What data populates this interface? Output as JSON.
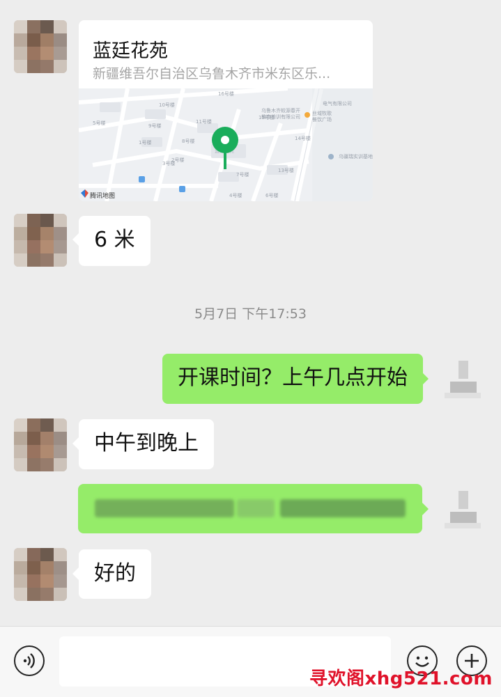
{
  "location": {
    "name": "蓝廷花苑",
    "address": "新疆维吾尔自治区乌鲁木齐市米东区乐...",
    "map_attribution": "腾讯地图",
    "map_labels": {
      "building_label": "蓝廷花苑",
      "poi1": "乌鲁木齐蛟源春开",
      "poi1_line2": "教育培训有限公司",
      "poi2": "丝域牧歌",
      "poi2_line2": "餐饮广场",
      "poi3": "电气有限公司",
      "poi4": "乌疆瑞实训基地",
      "road": "紫阳路",
      "buildings": [
        "16号楼",
        "10号楼",
        "11号楼",
        "9号楼",
        "8号楼",
        "1号楼",
        "3号楼",
        "2号楼",
        "15号楼",
        "14号楼",
        "13号楼",
        "7号楼",
        "4号楼",
        "5号楼",
        "6号楼"
      ]
    }
  },
  "messages": [
    {
      "side": "in",
      "text": "6 米"
    },
    {
      "side": "time",
      "text": "5月7日 下午17:53"
    },
    {
      "side": "out",
      "text": "开课时间？上午几点开始"
    },
    {
      "side": "in",
      "text": "中午到晚上"
    },
    {
      "side": "out",
      "text": "[blurred]"
    },
    {
      "side": "in",
      "text": "好的"
    }
  ],
  "input_bar": {
    "voice_icon": "voice-icon",
    "emoji_icon": "emoji-icon",
    "plus_icon": "plus-icon"
  },
  "watermark": "寻欢阁xhg521.com",
  "colors": {
    "outgoing_bubble": "#95ec69",
    "incoming_bubble": "#ffffff",
    "background": "#ededed",
    "map_pin": "#1aad5b",
    "watermark": "#e0122a"
  }
}
